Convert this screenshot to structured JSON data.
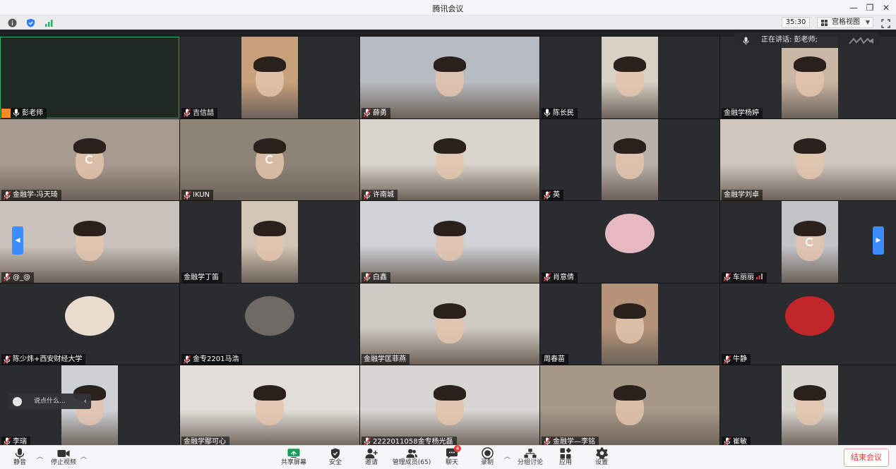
{
  "window": {
    "title": "腾讯会议"
  },
  "topbar": {
    "timer": "35:30",
    "view_label": "宫格视图"
  },
  "speaking": {
    "text": "正在讲话: 彭老师;"
  },
  "chat": {
    "placeholder": "说点什么..."
  },
  "participants": [
    {
      "name": "彭老师",
      "video": "none",
      "mic": "on",
      "host": true
    },
    {
      "name": "吉信喆",
      "video": "#c8a07a",
      "mic": "muted"
    },
    {
      "name": "薛勇",
      "video": "#b7bcc2",
      "mic": "muted"
    },
    {
      "name": "陈长民",
      "video": "#d8d1c6",
      "mic": "on"
    },
    {
      "name": "金融学杨婷",
      "video": "#c9b6a4",
      "mic": "none"
    },
    {
      "name": "金融学-冯天琦",
      "video": "#a79a90",
      "mic": "muted",
      "loading": true
    },
    {
      "name": "IKUN",
      "video": "#8d8376",
      "mic": "muted",
      "loading": true
    },
    {
      "name": "许南城",
      "video": "#d9d4cc",
      "mic": "muted"
    },
    {
      "name": "英",
      "video": "#b9b1aa",
      "mic": "muted"
    },
    {
      "name": "金融学刘卓",
      "video": "#cfc6bd",
      "mic": "none"
    },
    {
      "name": "@_@",
      "video": "#c9c2ba",
      "mic": "muted"
    },
    {
      "name": "金融学丁笛",
      "video": "#d2c5b5",
      "mic": "none"
    },
    {
      "name": "白鑫",
      "video": "#cfd2d6",
      "mic": "muted"
    },
    {
      "name": "肖意倩",
      "video": "avatar",
      "mic": "muted",
      "avatar_color": "#e6b8c2"
    },
    {
      "name": "车丽丽",
      "video": "#c2c4c8",
      "mic": "muted",
      "signal": true,
      "loading": true
    },
    {
      "name": "陈少炜+西安财经大学",
      "video": "avatar",
      "mic": "muted",
      "avatar_color": "#e9dccd"
    },
    {
      "name": "金专2201马浩",
      "video": "avatar",
      "mic": "muted",
      "avatar_color": "#6f6a66"
    },
    {
      "name": "金融学匡菲燕",
      "video": "#cfc9c3",
      "mic": "none"
    },
    {
      "name": "周春苗",
      "video": "#b49379",
      "mic": "none"
    },
    {
      "name": "牛静",
      "video": "avatar",
      "mic": "muted",
      "avatar_color": "#c0262a"
    },
    {
      "name": "李瑞",
      "video": "#cdd1d6",
      "mic": "muted"
    },
    {
      "name": "金融学鄢可心",
      "video": "#e2ddd8",
      "mic": "none"
    },
    {
      "name": "2222011058金专杨光磊",
      "video": "#d7d6d3",
      "mic": "muted"
    },
    {
      "name": "金融学—李铭",
      "video": "#a69787",
      "mic": "muted"
    },
    {
      "name": "崔敏",
      "video": "#d9d5d0",
      "mic": "muted"
    }
  ],
  "bottombar": {
    "mute": "静音",
    "stop_video": "停止视频",
    "share": "共享屏幕",
    "security": "安全",
    "invite": "邀请",
    "members": "管理成员(65)",
    "chat": "聊天",
    "chat_badge": "4",
    "record": "录制",
    "breakout": "分组讨论",
    "apps": "应用",
    "settings": "设置",
    "end": "结束会议"
  },
  "colors": {
    "accent": "#3d8cff",
    "end_red": "#e23b3b",
    "active_border": "#2fb06a"
  }
}
